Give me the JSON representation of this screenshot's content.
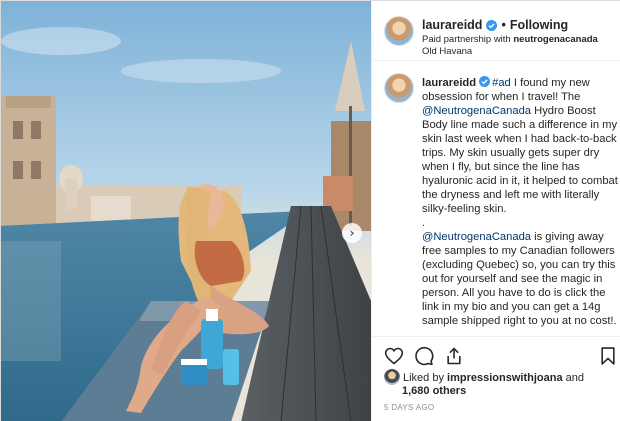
{
  "header": {
    "username": "laurareidd",
    "separator": "•",
    "follow_label": "Following",
    "partnership_prefix": "Paid partnership with ",
    "partner": "neutrogenacanada",
    "location": "Old Havana"
  },
  "caption": {
    "username": "laurareidd",
    "hashtag": "#ad",
    "text1": " I found my new obsession for when I travel! The ",
    "mention1": "@NeutrogenaCanada",
    "text2": " Hydro Boost Body line made such a difference in my skin last week when I had back-to-back trips. My skin usually gets super dry when I fly, but since the line has hyaluronic acid in it, it helped to combat the dryness and left me with literally silky-feeling skin.",
    "dot": ".",
    "mention2": "@NeutrogenaCanada",
    "text3": " is giving away free samples to my Canadian followers (excluding Quebec) so, you can try this out for yourself and see the magic in person. All you have to do is click the link in my bio and you can get a 14g sample shipped right to you at no cost!."
  },
  "likes": {
    "prefix": "Liked by ",
    "user": "impressionswithjoana",
    "and": " and",
    "others": "1,680 others"
  },
  "timestamp": "5 DAYS AGO",
  "icons": [
    "verified-badge-icon",
    "heart-icon",
    "comment-icon",
    "share-icon",
    "bookmark-icon",
    "chevron-right-icon"
  ],
  "colors": {
    "verified": "#3897f0",
    "link": "#00376b",
    "muted": "#8e8e8e"
  }
}
